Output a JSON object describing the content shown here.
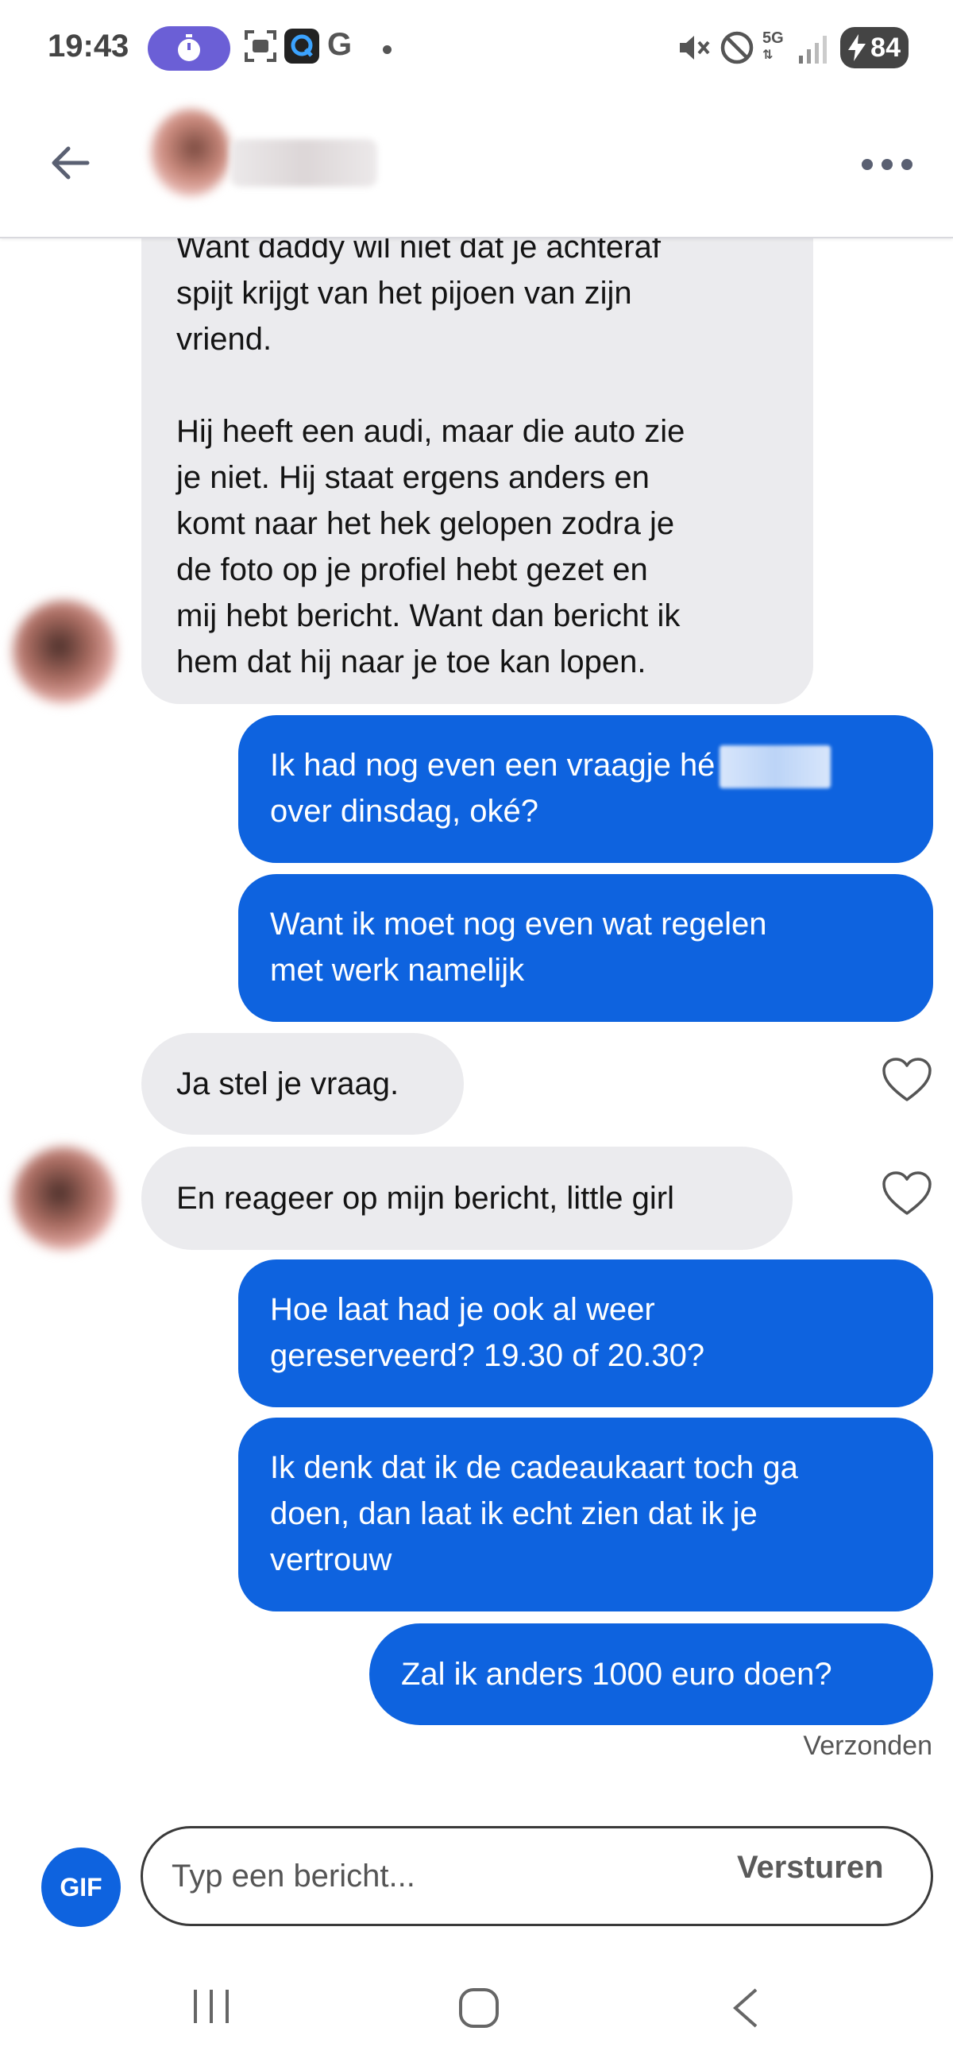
{
  "status_bar": {
    "time": "19:43",
    "extra_app_letter": "G",
    "network": "5G",
    "battery": "84"
  },
  "header": {
    "back_icon": "arrow-left-icon",
    "more_icon": "more-horizontal-icon"
  },
  "messages": [
    {
      "direction": "incoming",
      "lines": [
        "Want daddy wil niet dat je achteraf",
        "spijt krijgt van het pijoen van zijn",
        "vriend.",
        "",
        "Hij heeft een audi, maar die auto zie",
        "je niet. Hij staat ergens anders en",
        "komt naar het hek gelopen zodra je",
        "de foto op je profiel hebt gezet en",
        "mij hebt bericht. Want dan bericht ik",
        "hem dat hij naar je toe kan lopen."
      ]
    },
    {
      "direction": "outgoing",
      "lines": [
        "Ik had nog even een vraagje hé",
        "over dinsdag, oké?"
      ]
    },
    {
      "direction": "outgoing",
      "lines": [
        "Want ik moet nog even wat regelen",
        "met werk namelijk"
      ]
    },
    {
      "direction": "incoming",
      "lines": [
        "Ja stel je vraag."
      ]
    },
    {
      "direction": "incoming",
      "lines": [
        "En reageer op mijn bericht, little girl"
      ]
    },
    {
      "direction": "outgoing",
      "lines": [
        "Hoe laat had je ook al weer",
        "gereserveerd? 19.30 of 20.30?"
      ]
    },
    {
      "direction": "outgoing",
      "lines": [
        "Ik denk dat ik de cadeaukaart toch ga",
        "doen, dan laat ik echt zien dat ik je",
        "vertrouw"
      ]
    },
    {
      "direction": "outgoing",
      "lines": [
        "Zal ik anders 1000 euro doen?"
      ]
    }
  ],
  "sent_status": "Verzonden",
  "composer": {
    "gif_label": "GIF",
    "placeholder": "Typ een bericht...",
    "send_label": "Versturen"
  },
  "colors": {
    "outgoing_bubble": "#0e63df",
    "incoming_bubble": "#ebebee",
    "timer_pill": "#6b5fd6"
  }
}
